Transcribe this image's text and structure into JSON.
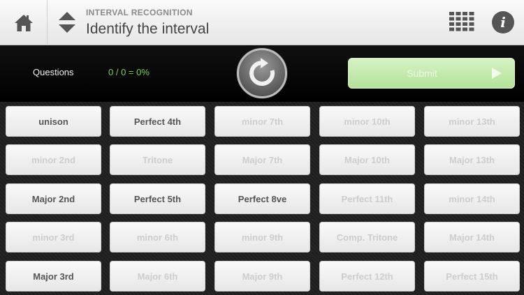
{
  "header": {
    "subtitle": "INTERVAL RECOGNITION",
    "title": "Identify the interval",
    "home_icon": "home-icon",
    "updown_icon": "up-down-arrows-icon",
    "grid_icon": "grid-menu-icon",
    "info_icon": "info-icon",
    "info_glyph": "i"
  },
  "status": {
    "questions_label": "Questions",
    "score": "0 / 0 = 0%",
    "replay_icon": "replay-icon",
    "submit_label": "Submit",
    "submit_icon": "play-arrow-icon"
  },
  "colors": {
    "score_green": "#7cd24a",
    "submit_green": "#b3e29a",
    "enabled_text": "#555555",
    "disabled_text": "#cdcdcd"
  },
  "intervals": [
    {
      "label": "unison",
      "enabled": true
    },
    {
      "label": "Perfect 4th",
      "enabled": true
    },
    {
      "label": "minor 7th",
      "enabled": false
    },
    {
      "label": "minor 10th",
      "enabled": false
    },
    {
      "label": "minor 13th",
      "enabled": false
    },
    {
      "label": "minor 2nd",
      "enabled": false
    },
    {
      "label": "Tritone",
      "enabled": false
    },
    {
      "label": "Major 7th",
      "enabled": false
    },
    {
      "label": "Major 10th",
      "enabled": false
    },
    {
      "label": "Major 13th",
      "enabled": false
    },
    {
      "label": "Major 2nd",
      "enabled": true
    },
    {
      "label": "Perfect 5th",
      "enabled": true
    },
    {
      "label": "Perfect 8ve",
      "enabled": true
    },
    {
      "label": "Perfect 11th",
      "enabled": false
    },
    {
      "label": "minor 14th",
      "enabled": false
    },
    {
      "label": "minor 3rd",
      "enabled": false
    },
    {
      "label": "minor 6th",
      "enabled": false
    },
    {
      "label": "minor 9th",
      "enabled": false
    },
    {
      "label": "Comp. Tritone",
      "enabled": false
    },
    {
      "label": "Major 14th",
      "enabled": false
    },
    {
      "label": "Major 3rd",
      "enabled": true
    },
    {
      "label": "Major 6th",
      "enabled": false
    },
    {
      "label": "Major 9th",
      "enabled": false
    },
    {
      "label": "Perfect 12th",
      "enabled": false
    },
    {
      "label": "Perfect 15th",
      "enabled": false
    }
  ]
}
